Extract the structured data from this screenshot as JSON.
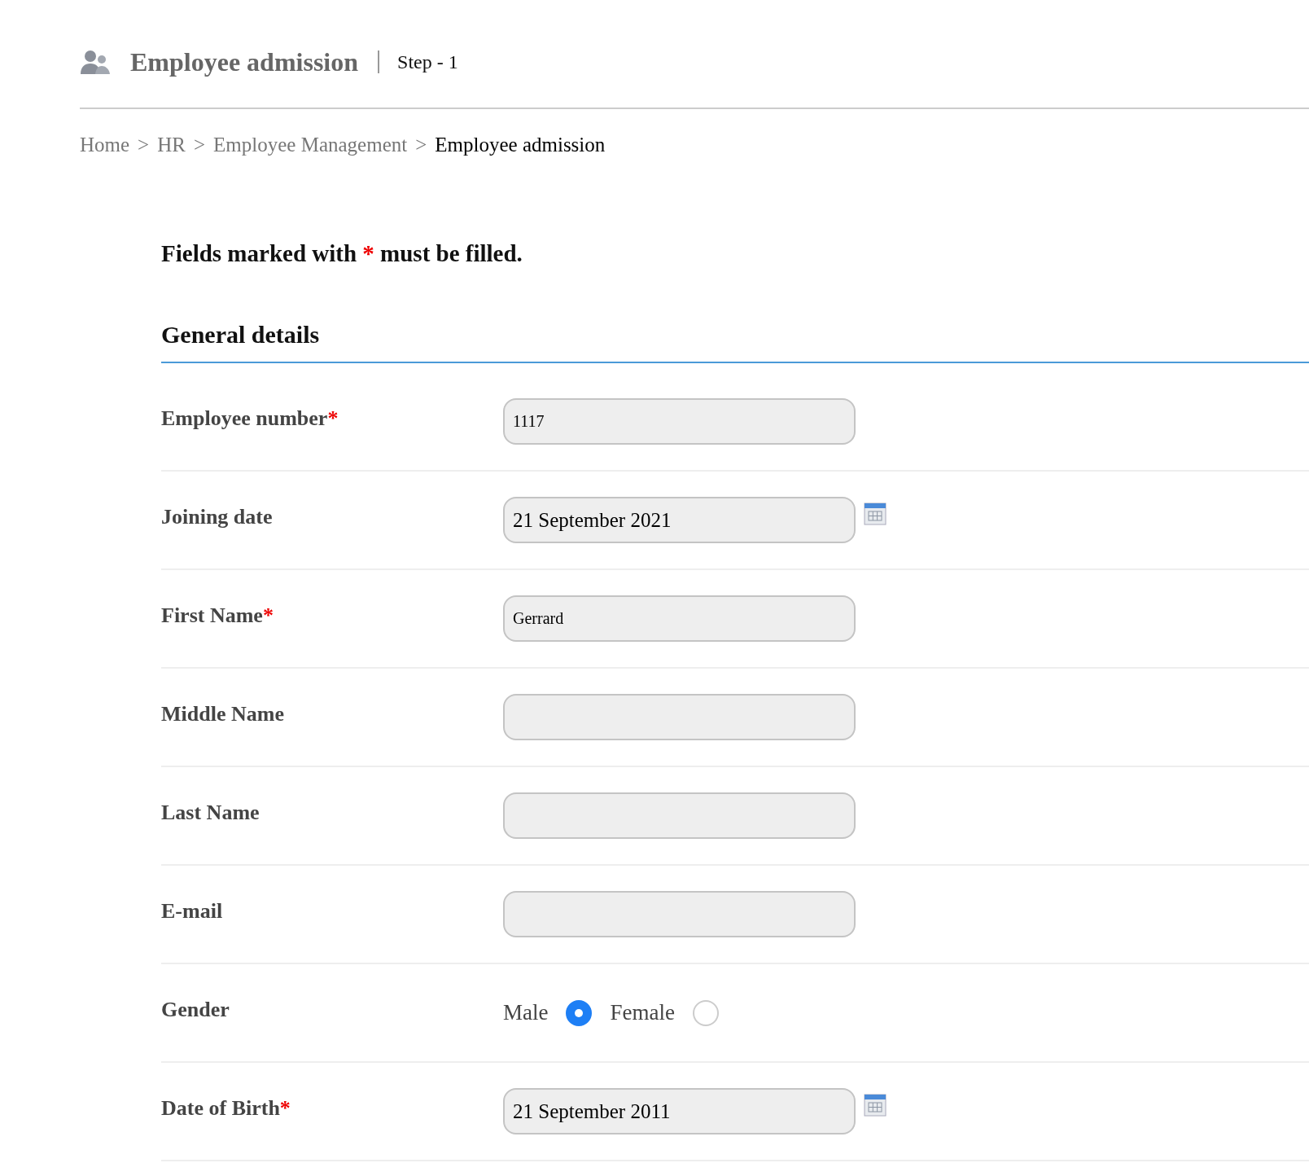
{
  "header": {
    "title": "Employee admission",
    "step": "Step - 1"
  },
  "breadcrumb": [
    {
      "label": "Home",
      "current": false
    },
    {
      "label": "HR",
      "current": false
    },
    {
      "label": "Employee Management",
      "current": false
    },
    {
      "label": "Employee admission",
      "current": true
    }
  ],
  "breadcrumb_separator": ">",
  "notice": {
    "before": "Fields marked with",
    "mark": "*",
    "after": "must be filled."
  },
  "section": {
    "title": "General details"
  },
  "fields": [
    {
      "kind": "text",
      "label": "Employee number",
      "required": true,
      "value": "1117"
    },
    {
      "kind": "date",
      "label": "Joining date",
      "required": false,
      "value": "21 September 2021"
    },
    {
      "kind": "text",
      "label": "First Name",
      "required": true,
      "value": "Gerrard"
    },
    {
      "kind": "text",
      "label": "Middle Name",
      "required": false
    },
    {
      "kind": "text",
      "label": "Last Name",
      "required": false
    },
    {
      "kind": "text",
      "label": "E-mail",
      "required": false
    },
    {
      "kind": "radio",
      "label": "Gender",
      "required": false,
      "options": [
        {
          "label": "Male",
          "selected": true
        },
        {
          "label": "Female",
          "selected": false
        }
      ]
    },
    {
      "kind": "date",
      "label": "Date of Birth",
      "required": true,
      "value": "21 September 2011"
    }
  ]
}
